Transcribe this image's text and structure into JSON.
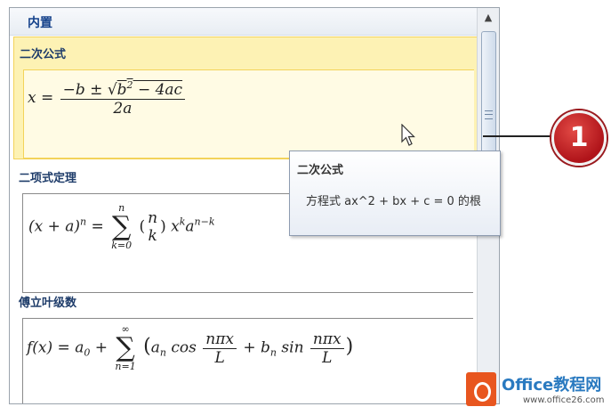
{
  "gallery": {
    "header": "内置",
    "items": [
      {
        "title": "二次公式"
      },
      {
        "title": "二项式定理"
      },
      {
        "title": "傅立叶级数"
      }
    ]
  },
  "tooltip": {
    "title": "二次公式",
    "body": "方程式 ax^2 + bx + c = 0 的根"
  },
  "callout": {
    "number": "1"
  },
  "watermark": {
    "brand": "Office教程网",
    "url": "www.office26.com"
  },
  "colors": {
    "hover_fill": "#fdf2b4",
    "callout_red": "#c0161c",
    "header_text": "#15428b"
  },
  "icons": [
    "scroll-up-icon",
    "scrollbar-grip-icon",
    "mouse-pointer-icon",
    "office-logo-icon"
  ]
}
